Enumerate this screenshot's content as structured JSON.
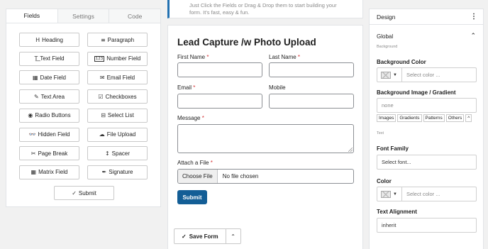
{
  "left_panel": {
    "tabs": [
      "Fields",
      "Settings",
      "Code"
    ],
    "fields": [
      {
        "label": "Heading",
        "icon": "heading-icon",
        "glyph": "H"
      },
      {
        "label": "Paragraph",
        "icon": "paragraph-icon",
        "glyph": "≡"
      },
      {
        "label": "Text Field",
        "icon": "text-field-icon",
        "glyph": "T͟"
      },
      {
        "label": "Number Field",
        "icon": "number-icon",
        "glyph": "123"
      },
      {
        "label": "Date Field",
        "icon": "calendar-icon",
        "glyph": "▦"
      },
      {
        "label": "Email Field",
        "icon": "envelope-icon",
        "glyph": "✉"
      },
      {
        "label": "Text Area",
        "icon": "edit-icon",
        "glyph": "✎"
      },
      {
        "label": "Checkboxes",
        "icon": "checkbox-icon",
        "glyph": "☑"
      },
      {
        "label": "Radio Buttons",
        "icon": "radio-icon",
        "glyph": "◉"
      },
      {
        "label": "Select List",
        "icon": "select-icon",
        "glyph": "⊟"
      },
      {
        "label": "Hidden Field",
        "icon": "hidden-icon",
        "glyph": "👓"
      },
      {
        "label": "File Upload",
        "icon": "upload-icon",
        "glyph": "☁"
      },
      {
        "label": "Page Break",
        "icon": "scissors-icon",
        "glyph": "✂"
      },
      {
        "label": "Spacer",
        "icon": "spacer-icon",
        "glyph": "↕"
      },
      {
        "label": "Matrix Field",
        "icon": "table-icon",
        "glyph": "▦"
      },
      {
        "label": "Signature",
        "icon": "signature-icon",
        "glyph": "✒"
      }
    ],
    "submit": {
      "label": "Submit",
      "glyph": "✓"
    }
  },
  "notice": {
    "line1": "Just Click the Fields or Drag & Drop them to start building your",
    "line2": "form. It's fast, easy & fun."
  },
  "form": {
    "title": "Lead Capture /w Photo Upload",
    "first_name": "First Name",
    "last_name": "Last Name",
    "email": "Email",
    "mobile": "Mobile",
    "message": "Message",
    "attach": "Attach a File",
    "required_mark": "*",
    "choose_file": "Choose File",
    "no_file": "No file chosen",
    "submit": "Submit",
    "save_form": "Save Form",
    "save_glyph": "✓",
    "caret_glyph": "⌃"
  },
  "design": {
    "title": "Design",
    "menu_glyph": "⋮",
    "global": "Global",
    "collapse_glyph": "⌃",
    "background_small": "Background",
    "background_color": "Background Color",
    "select_color": "Select color ...",
    "bg_image": "Background Image / Gradient",
    "none": "none",
    "gradient_tabs": [
      "Images",
      "Gradients",
      "Patterns",
      "Others"
    ],
    "gradient_caret": "^",
    "text_small": "Text",
    "font_family": "Font Family",
    "select_font": "Select font...",
    "color": "Color",
    "select_color2": "Select color ...",
    "text_alignment": "Text Alignment",
    "inherit": "inherit",
    "dropdown_glyph": "▼"
  }
}
